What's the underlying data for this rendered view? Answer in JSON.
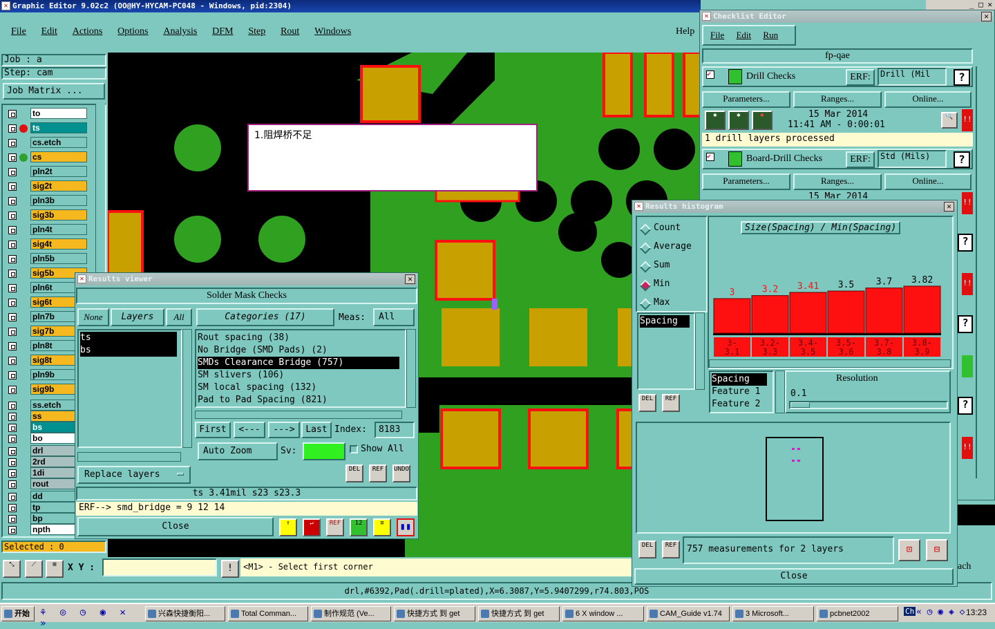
{
  "main": {
    "title": "Graphic Editor 9.02c2 (OO@HY-HYCAM-PC048 - Windows, pid:2304)",
    "menu": [
      "File",
      "Edit",
      "Actions",
      "Options",
      "Analysis",
      "DFM",
      "Step",
      "Rout",
      "Windows"
    ],
    "help": "Help",
    "job": "Job : a",
    "step": "Step: cam",
    "job_matrix": "Job Matrix ...",
    "selected": "Selected : 0",
    "xy_label": "X Y :",
    "prompt": "<M1> - Select first corner",
    "status_line": "drl,#6392,Pad(.drill=plated),X=6.3087,Y=5.9407299,r74.803,POS",
    "note_text": "1.阻焊桥不足",
    "partial_label": "ach"
  },
  "layers": [
    {
      "name": "to",
      "style": "white",
      "dot": "",
      "color": ""
    },
    {
      "name": "ts",
      "style": "white",
      "dot": "red",
      "color": "#e01010"
    },
    {
      "name": "cs.etch",
      "style": "plain",
      "dot": "",
      "color": ""
    },
    {
      "name": "cs",
      "style": "orange",
      "dot": "green",
      "color": "#30a030"
    },
    {
      "name": "pln2t",
      "style": "plain",
      "dot": "",
      "color": ""
    },
    {
      "name": "sig2t",
      "style": "orange",
      "dot": "",
      "color": ""
    },
    {
      "name": "pln3b",
      "style": "plain",
      "dot": "",
      "color": ""
    },
    {
      "name": "sig3b",
      "style": "orange",
      "dot": "",
      "color": ""
    },
    {
      "name": "pln4t",
      "style": "plain",
      "dot": "",
      "color": ""
    },
    {
      "name": "sig4t",
      "style": "orange",
      "dot": "",
      "color": ""
    },
    {
      "name": "pln5b",
      "style": "plain",
      "dot": "",
      "color": ""
    },
    {
      "name": "sig5b",
      "style": "orange",
      "dot": "",
      "color": ""
    },
    {
      "name": "pln6t",
      "style": "plain",
      "dot": "",
      "color": ""
    },
    {
      "name": "sig6t",
      "style": "orange",
      "dot": "",
      "color": ""
    },
    {
      "name": "pln7b",
      "style": "plain",
      "dot": "",
      "color": ""
    },
    {
      "name": "sig7b",
      "style": "orange",
      "dot": "",
      "color": ""
    },
    {
      "name": "pln8t",
      "style": "plain",
      "dot": "",
      "color": ""
    },
    {
      "name": "sig8t",
      "style": "orange",
      "dot": "",
      "color": ""
    },
    {
      "name": "pln9b",
      "style": "plain",
      "dot": "",
      "color": ""
    },
    {
      "name": "sig9b",
      "style": "orange",
      "dot": "",
      "color": ""
    },
    {
      "name": "ss.etch",
      "style": "plain",
      "dot": "",
      "color": ""
    },
    {
      "name": "ss",
      "style": "orange",
      "dot": "",
      "color": ""
    },
    {
      "name": "bs",
      "style": "plain",
      "dot": "",
      "color": ""
    },
    {
      "name": "bo",
      "style": "white",
      "dot": "",
      "color": ""
    },
    {
      "name": "drl",
      "style": "grey",
      "dot": "",
      "color": ""
    },
    {
      "name": "2rd",
      "style": "grey",
      "dot": "",
      "color": ""
    },
    {
      "name": "1di",
      "style": "grey",
      "dot": "",
      "color": ""
    },
    {
      "name": "rout",
      "style": "grey",
      "dot": "",
      "color": ""
    },
    {
      "name": "dd",
      "style": "plain",
      "dot": "",
      "color": ""
    },
    {
      "name": "tp",
      "style": "plain",
      "dot": "",
      "color": ""
    },
    {
      "name": "bp",
      "style": "plain",
      "dot": "",
      "color": ""
    },
    {
      "name": "npth",
      "style": "white",
      "dot": "",
      "color": ""
    }
  ],
  "checklist": {
    "title": "Checklist Editor",
    "menu": [
      "File",
      "Edit",
      "Run"
    ],
    "name": "fp-qae",
    "checks": [
      {
        "name": "Drill Checks",
        "erf_label": "ERF:",
        "erf": "Drill (Mil",
        "params": "Parameters...",
        "ranges": "Ranges...",
        "online": "Online...",
        "date": "15 Mar 2014",
        "time": "11:41 AM - 0:00:01",
        "summary": "1 drill layers processed"
      },
      {
        "name": "Board-Drill Checks",
        "erf_label": "ERF:",
        "erf": "Std (Mils)",
        "params": "Parameters...",
        "ranges": "Ranges...",
        "online": "Online...",
        "date": "15 Mar 2014"
      }
    ]
  },
  "results_viewer": {
    "title": "Results viewer",
    "heading": "Solder Mask Checks",
    "none_btn": "None",
    "layers_btn": "Layers",
    "all_btn": "All",
    "categories_btn": "Categories (17)",
    "meas_label": "Meas:",
    "meas_value": "All",
    "layer_list": [
      "ts",
      "bs"
    ],
    "categories": [
      "Rout spacing (38)",
      "No Bridge (SMD Pads) (2)",
      "SMDs Clearance Bridge (757)",
      "SM slivers (106)",
      "SM local spacing (132)",
      "Pad to Pad Spacing (821)"
    ],
    "selected_category": 2,
    "first": "First",
    "prev": "<---",
    "next": "--->",
    "last": "Last",
    "index_label": "Index:",
    "index_value": "8183",
    "auto_zoom": "Auto Zoom",
    "sv_label": "Sv:",
    "show_all": "Show All",
    "replace_layers": "Replace layers",
    "info": "ts 3.41mil  s23  s23.3",
    "erf_line": "ERF--> smd_bridge = 9 12 14",
    "close": "Close"
  },
  "histogram": {
    "title": "Results histogram",
    "radios": [
      "Count",
      "Average",
      "Sum",
      "Min",
      "Max"
    ],
    "selected_radio": "Min",
    "measure_list": [
      "Spacing"
    ],
    "chart_title": "Size(Spacing) / Min(Spacing)",
    "del": "DEL",
    "ref": "REF",
    "props": [
      "Spacing",
      "Feature 1",
      "Feature 2"
    ],
    "resolution_label": "Resolution",
    "resolution_value": "0.1",
    "summary": "757 measurements for 2 layers",
    "close": "Close"
  },
  "chart_data": {
    "type": "bar",
    "title": "Size(Spacing) / Min(Spacing)",
    "categories": [
      "3-\n3.1",
      "3.2-\n3.3",
      "3.4-\n3.5",
      "3.5-\n3.6",
      "3.7-\n3.8",
      "3.8-\n3.9"
    ],
    "category_labels": [
      [
        "3-",
        "3.1"
      ],
      [
        "3.2-",
        "3.3"
      ],
      [
        "3.4-",
        "3.5"
      ],
      [
        "3.5-",
        "3.6"
      ],
      [
        "3.7-",
        "3.8"
      ],
      [
        "3.8-",
        "3.9"
      ]
    ],
    "values": [
      3,
      3.2,
      3.41,
      3.5,
      3.7,
      3.82
    ],
    "value_labels": [
      "3",
      "3.2",
      "3.41",
      "3.5",
      "3.7",
      "3.82"
    ],
    "value_label_colors": [
      "#ff1010",
      "#ff1010",
      "#ff1010",
      "#000000",
      "#000000",
      "#000000"
    ],
    "bar_color": "#ff1010",
    "ylim": [
      0,
      6
    ]
  },
  "taskbar": {
    "start": "开始",
    "tasks": [
      "兴森快捷衡阳...",
      "Total Comman...",
      "制作规范 (Ve...",
      "快捷方式 到 get",
      "快捷方式 到 get",
      "6 X window ...",
      "CAM_Guide v1.74",
      "3 Microsoft...",
      "pcbnet2002"
    ],
    "clock": "13:23",
    "tray_label": "Ch"
  }
}
